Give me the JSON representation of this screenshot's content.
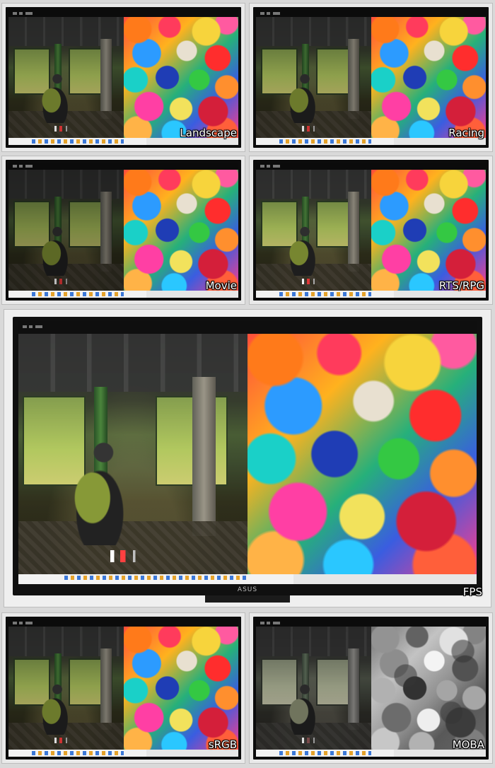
{
  "modes": {
    "landscape": "Landscape",
    "racing": "Racing",
    "movie": "Movie",
    "rts_rpg": "RTS/RPG",
    "fps": "FPS",
    "srgb": "sRGB",
    "moba": "MOBA"
  },
  "monitor": {
    "brand_logo": "ASUS"
  }
}
